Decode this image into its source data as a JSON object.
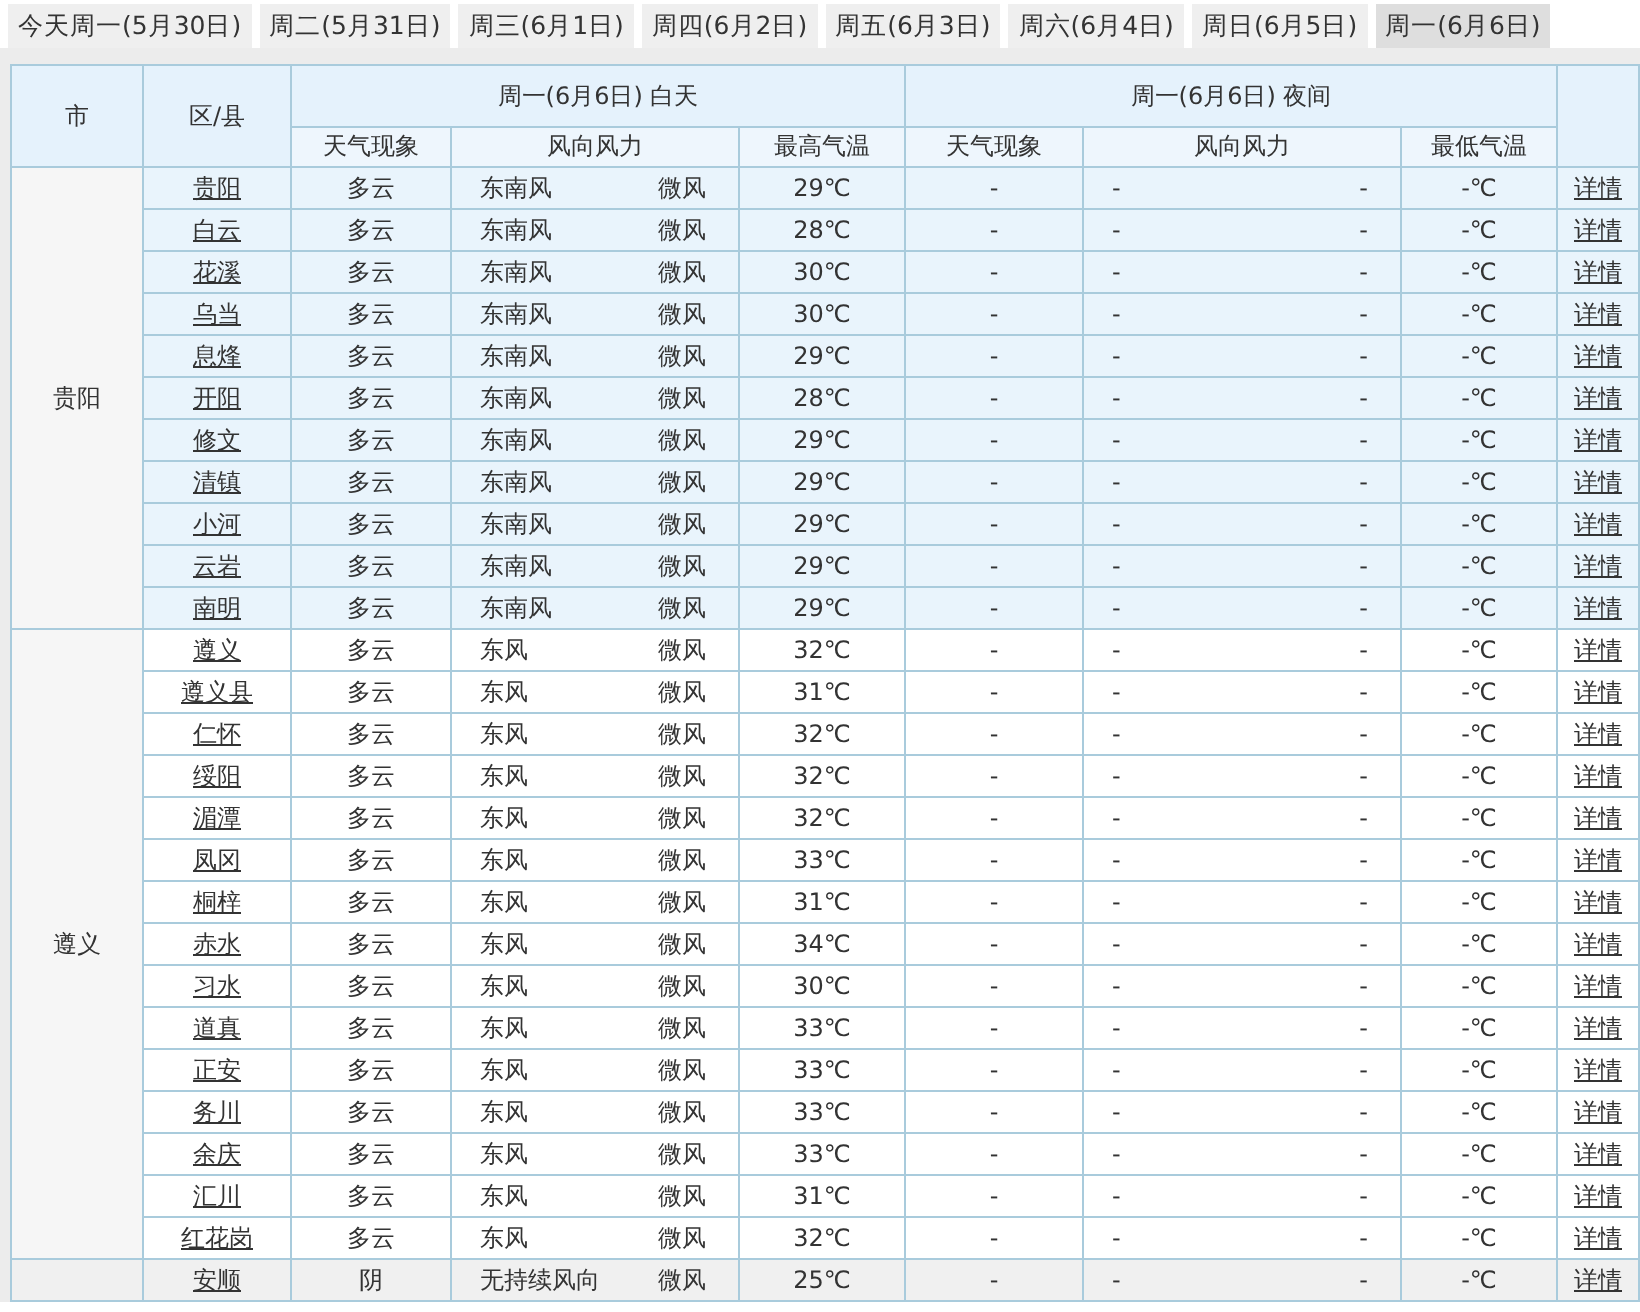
{
  "tabs": [
    {
      "label": "今天周一(5月30日)",
      "selected": false
    },
    {
      "label": "周二(5月31日)",
      "selected": false
    },
    {
      "label": "周三(6月1日)",
      "selected": false
    },
    {
      "label": "周四(6月2日)",
      "selected": false
    },
    {
      "label": "周五(6月3日)",
      "selected": false
    },
    {
      "label": "周六(6月4日)",
      "selected": false
    },
    {
      "label": "周日(6月5日)",
      "selected": false
    },
    {
      "label": "周一(6月6日)",
      "selected": true
    }
  ],
  "header": {
    "city": "市",
    "district": "区/县",
    "day_title": "周一(6月6日) 白天",
    "night_title": "周一(6月6日) 夜间",
    "day_columns": [
      "天气现象",
      "风向风力",
      "最高气温"
    ],
    "night_columns": [
      "天气现象",
      "风向风力",
      "最低气温"
    ]
  },
  "groups": [
    {
      "city": "贵阳",
      "kind": "highlighted",
      "rows": [
        {
          "district": "贵阳",
          "weather": "多云",
          "wind_dir": "东南风",
          "wind_force": "微风",
          "high": "29℃",
          "night_weather": "-",
          "night_wind_dir": "-",
          "night_wind_force": "-",
          "low": "-℃",
          "link": "详情"
        },
        {
          "district": "白云",
          "weather": "多云",
          "wind_dir": "东南风",
          "wind_force": "微风",
          "high": "28℃",
          "night_weather": "-",
          "night_wind_dir": "-",
          "night_wind_force": "-",
          "low": "-℃",
          "link": "详情"
        },
        {
          "district": "花溪",
          "weather": "多云",
          "wind_dir": "东南风",
          "wind_force": "微风",
          "high": "30℃",
          "night_weather": "-",
          "night_wind_dir": "-",
          "night_wind_force": "-",
          "low": "-℃",
          "link": "详情"
        },
        {
          "district": "乌当",
          "weather": "多云",
          "wind_dir": "东南风",
          "wind_force": "微风",
          "high": "30℃",
          "night_weather": "-",
          "night_wind_dir": "-",
          "night_wind_force": "-",
          "low": "-℃",
          "link": "详情"
        },
        {
          "district": "息烽",
          "weather": "多云",
          "wind_dir": "东南风",
          "wind_force": "微风",
          "high": "29℃",
          "night_weather": "-",
          "night_wind_dir": "-",
          "night_wind_force": "-",
          "low": "-℃",
          "link": "详情"
        },
        {
          "district": "开阳",
          "weather": "多云",
          "wind_dir": "东南风",
          "wind_force": "微风",
          "high": "28℃",
          "night_weather": "-",
          "night_wind_dir": "-",
          "night_wind_force": "-",
          "low": "-℃",
          "link": "详情"
        },
        {
          "district": "修文",
          "weather": "多云",
          "wind_dir": "东南风",
          "wind_force": "微风",
          "high": "29℃",
          "night_weather": "-",
          "night_wind_dir": "-",
          "night_wind_force": "-",
          "low": "-℃",
          "link": "详情"
        },
        {
          "district": "清镇",
          "weather": "多云",
          "wind_dir": "东南风",
          "wind_force": "微风",
          "high": "29℃",
          "night_weather": "-",
          "night_wind_dir": "-",
          "night_wind_force": "-",
          "low": "-℃",
          "link": "详情"
        },
        {
          "district": "小河",
          "weather": "多云",
          "wind_dir": "东南风",
          "wind_force": "微风",
          "high": "29℃",
          "night_weather": "-",
          "night_wind_dir": "-",
          "night_wind_force": "-",
          "low": "-℃",
          "link": "详情"
        },
        {
          "district": "云岩",
          "weather": "多云",
          "wind_dir": "东南风",
          "wind_force": "微风",
          "high": "29℃",
          "night_weather": "-",
          "night_wind_dir": "-",
          "night_wind_force": "-",
          "low": "-℃",
          "link": "详情"
        },
        {
          "district": "南明",
          "weather": "多云",
          "wind_dir": "东南风",
          "wind_force": "微风",
          "high": "29℃",
          "night_weather": "-",
          "night_wind_dir": "-",
          "night_wind_force": "-",
          "low": "-℃",
          "link": "详情"
        }
      ]
    },
    {
      "city": "遵义",
      "kind": "plain",
      "rows": [
        {
          "district": "遵义",
          "weather": "多云",
          "wind_dir": "东风",
          "wind_force": "微风",
          "high": "32℃",
          "night_weather": "-",
          "night_wind_dir": "-",
          "night_wind_force": "-",
          "low": "-℃",
          "link": "详情"
        },
        {
          "district": "遵义县",
          "weather": "多云",
          "wind_dir": "东风",
          "wind_force": "微风",
          "high": "31℃",
          "night_weather": "-",
          "night_wind_dir": "-",
          "night_wind_force": "-",
          "low": "-℃",
          "link": "详情"
        },
        {
          "district": "仁怀",
          "weather": "多云",
          "wind_dir": "东风",
          "wind_force": "微风",
          "high": "32℃",
          "night_weather": "-",
          "night_wind_dir": "-",
          "night_wind_force": "-",
          "low": "-℃",
          "link": "详情"
        },
        {
          "district": "绥阳",
          "weather": "多云",
          "wind_dir": "东风",
          "wind_force": "微风",
          "high": "32℃",
          "night_weather": "-",
          "night_wind_dir": "-",
          "night_wind_force": "-",
          "low": "-℃",
          "link": "详情"
        },
        {
          "district": "湄潭",
          "weather": "多云",
          "wind_dir": "东风",
          "wind_force": "微风",
          "high": "32℃",
          "night_weather": "-",
          "night_wind_dir": "-",
          "night_wind_force": "-",
          "low": "-℃",
          "link": "详情"
        },
        {
          "district": "凤冈",
          "weather": "多云",
          "wind_dir": "东风",
          "wind_force": "微风",
          "high": "33℃",
          "night_weather": "-",
          "night_wind_dir": "-",
          "night_wind_force": "-",
          "low": "-℃",
          "link": "详情"
        },
        {
          "district": "桐梓",
          "weather": "多云",
          "wind_dir": "东风",
          "wind_force": "微风",
          "high": "31℃",
          "night_weather": "-",
          "night_wind_dir": "-",
          "night_wind_force": "-",
          "low": "-℃",
          "link": "详情"
        },
        {
          "district": "赤水",
          "weather": "多云",
          "wind_dir": "东风",
          "wind_force": "微风",
          "high": "34℃",
          "night_weather": "-",
          "night_wind_dir": "-",
          "night_wind_force": "-",
          "low": "-℃",
          "link": "详情"
        },
        {
          "district": "习水",
          "weather": "多云",
          "wind_dir": "东风",
          "wind_force": "微风",
          "high": "30℃",
          "night_weather": "-",
          "night_wind_dir": "-",
          "night_wind_force": "-",
          "low": "-℃",
          "link": "详情"
        },
        {
          "district": "道真",
          "weather": "多云",
          "wind_dir": "东风",
          "wind_force": "微风",
          "high": "33℃",
          "night_weather": "-",
          "night_wind_dir": "-",
          "night_wind_force": "-",
          "low": "-℃",
          "link": "详情"
        },
        {
          "district": "正安",
          "weather": "多云",
          "wind_dir": "东风",
          "wind_force": "微风",
          "high": "33℃",
          "night_weather": "-",
          "night_wind_dir": "-",
          "night_wind_force": "-",
          "low": "-℃",
          "link": "详情"
        },
        {
          "district": "务川",
          "weather": "多云",
          "wind_dir": "东风",
          "wind_force": "微风",
          "high": "33℃",
          "night_weather": "-",
          "night_wind_dir": "-",
          "night_wind_force": "-",
          "low": "-℃",
          "link": "详情"
        },
        {
          "district": "余庆",
          "weather": "多云",
          "wind_dir": "东风",
          "wind_force": "微风",
          "high": "33℃",
          "night_weather": "-",
          "night_wind_dir": "-",
          "night_wind_force": "-",
          "low": "-℃",
          "link": "详情"
        },
        {
          "district": "汇川",
          "weather": "多云",
          "wind_dir": "东风",
          "wind_force": "微风",
          "high": "31℃",
          "night_weather": "-",
          "night_wind_dir": "-",
          "night_wind_force": "-",
          "low": "-℃",
          "link": "详情"
        },
        {
          "district": "红花岗",
          "weather": "多云",
          "wind_dir": "东风",
          "wind_force": "微风",
          "high": "32℃",
          "night_weather": "-",
          "night_wind_dir": "-",
          "night_wind_force": "-",
          "low": "-℃",
          "link": "详情"
        }
      ]
    },
    {
      "kind": "shaded",
      "rows": [
        {
          "district": "安顺",
          "weather": "阴",
          "wind_dir": "无持续风向",
          "wind_force": "微风",
          "high": "25℃",
          "night_weather": "-",
          "night_wind_dir": "-",
          "night_wind_force": "-",
          "low": "-℃",
          "link": "详情"
        }
      ]
    }
  ]
}
